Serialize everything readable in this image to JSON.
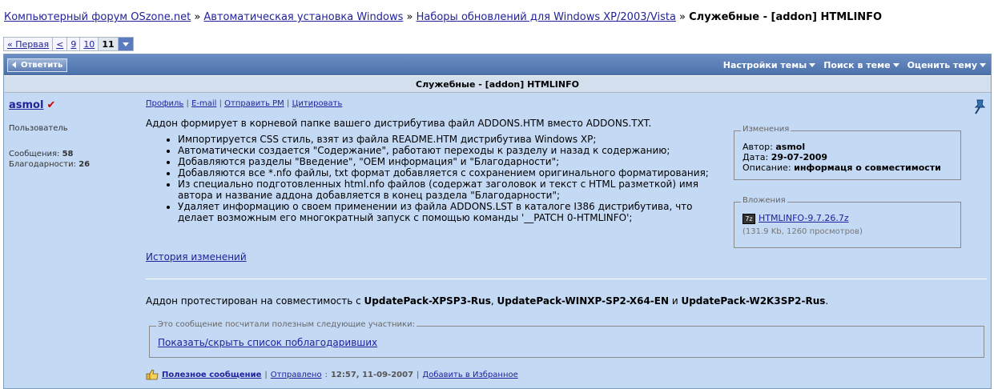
{
  "breadcrumb": {
    "items": [
      "Компьютерный форум OSzone.net",
      "Автоматическая установка Windows",
      "Наборы обновлений для Windows XP/2003/Vista"
    ],
    "separator": " » ",
    "current": "Служебные - [addon] HTMLINFO"
  },
  "pager": {
    "first": "« Первая",
    "prev": "<",
    "pages": [
      "9",
      "10"
    ],
    "current": "11"
  },
  "thread_toolbar": {
    "reply": "Ответить",
    "settings": "Настройки темы",
    "search": "Поиск в теме",
    "rate": "Оценить тему"
  },
  "post": {
    "title": "Служебные - [addon] HTMLINFO",
    "user": {
      "name": "asmol",
      "role": "Пользователь",
      "messages_label": "Сообщения:",
      "messages": "58",
      "thanks_label": "Благодарности:",
      "thanks": "26"
    },
    "links": [
      "Профиль",
      "E-mail",
      "Отправить PM",
      "Цитировать"
    ],
    "intro": "Аддон формирует в корневой папке вашего дистрибутива файл ADDONS.HTM вместо ADDONS.TXT.",
    "bullets": [
      "Импортируется CSS стиль, взят из файла README.HTM дистрибутива Windows XP;",
      "Автоматически создается \"Содержание\", работают переходы к разделу и назад к содержанию;",
      "Добавляются разделы \"Введение\", \"OEM информация\" и \"Благодарности\";",
      "Добавляются все *.nfo файлы, txt формат добавляется с сохранением оригинального форматирования;",
      "Из специально подготовленных html.nfo файлов (содержат заголовок и текст с HTML разметкой) имя автора и название аддона добавляется в конец раздела \"Благодарности\";",
      "Удаляет информацию о своем применении из файла ADDONS.LST в каталоге I386 дистрибутива, что делает возможным его многократный запуск с помощью команды '__PATCH 0-HTMLINFO';"
    ],
    "history_link": "История изменений",
    "changes": {
      "legend": "Изменения",
      "author_label": "Автор:",
      "author": "asmol",
      "date_label": "Дата:",
      "date": "29-07-2009",
      "desc_label": "Описание:",
      "desc": "информаця о совместимости"
    },
    "attachments": {
      "legend": "Вложения",
      "file": "HTMLINFO-9.7.26.7z",
      "info": "(131.9 Kb, 1260 просмотров)"
    },
    "compat": {
      "prefix": "Аддон протестирован на совместимость с ",
      "p1": "UpdatePack-XPSP3-Rus",
      "sep1": ", ",
      "p2": "UpdatePack-WINXP-SP2-X64-EN",
      "sep2": " и ",
      "p3": "UpdatePack-W2K3SP2-Rus",
      "suffix": "."
    },
    "thanks_box": {
      "legend": "Это сообщение посчитали полезным следующие участники:",
      "link": "Показать/скрыть список поблагодаривших"
    },
    "footer": {
      "useful": "Полезное сообщение",
      "sent_label": "Отправлено",
      "sent": "12:57, 11-09-2007",
      "favorites": "Добавить в Избранное"
    }
  }
}
